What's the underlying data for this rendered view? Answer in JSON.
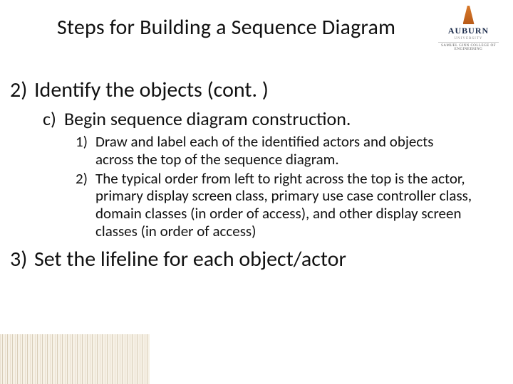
{
  "title": "Steps for Building a Sequence Diagram",
  "logo": {
    "university": "AUBURN",
    "line1": "UNIVERSITY",
    "line2": "SAMUEL GINN COLLEGE OF ENGINEERING"
  },
  "outline": {
    "item2": {
      "number": "2)",
      "text": "Identify the objects (cont. )",
      "c": {
        "number": "c)",
        "text": "Begin sequence diagram construction.",
        "sub1": {
          "number": "1)",
          "text": "Draw and label each of the identified actors and objects across the top of the sequence diagram."
        },
        "sub2": {
          "number": "2)",
          "text": "The typical order from left to right across the top is the actor, primary display screen class, primary use case controller class, domain classes (in order of access), and other display screen classes (in order of access)"
        }
      }
    },
    "item3": {
      "number": "3)",
      "text": "Set the lifeline for each object/actor"
    }
  }
}
